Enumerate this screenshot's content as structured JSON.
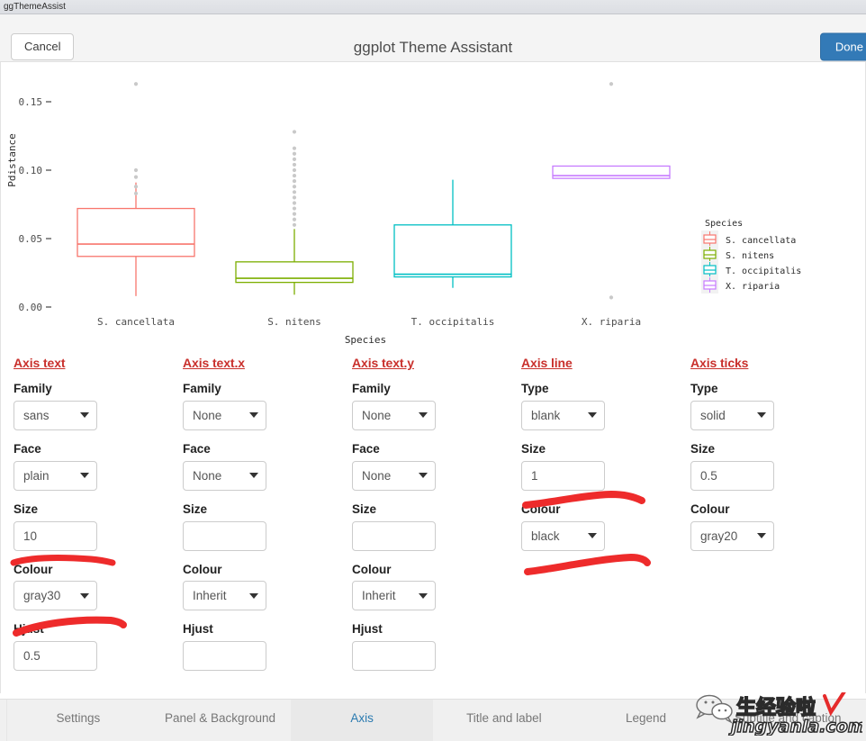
{
  "window": {
    "title": "ggThemeAssist"
  },
  "header": {
    "cancel_label": "Cancel",
    "title": "ggplot Theme Assistant",
    "done_label": "Done"
  },
  "plot": {
    "y_axis_title": "Pdistance",
    "x_axis_title": "Species",
    "y_ticks": [
      "0.00",
      "0.05",
      "0.10",
      "0.15"
    ],
    "x_ticks": [
      "S. cancellata",
      "S. nitens",
      "T. occipitalis",
      "X. riparia"
    ],
    "legend_title": "Species",
    "legend_items": [
      {
        "label": "S. cancellata",
        "colour": "#F8766D"
      },
      {
        "label": "S. nitens",
        "colour": "#7CAE00"
      },
      {
        "label": "T. occipitalis",
        "colour": "#00BFC4"
      },
      {
        "label": "X. riparia",
        "colour": "#C77CFF"
      }
    ]
  },
  "chart_data": {
    "type": "box",
    "title": "",
    "xlabel": "Species",
    "ylabel": "Pdistance",
    "categories": [
      "S. cancellata",
      "S. nitens",
      "T. occipitalis",
      "X. riparia"
    ],
    "ylim": [
      0.0,
      0.175
    ],
    "grid": false,
    "legend_position": "right",
    "series": [
      {
        "name": "S. cancellata",
        "colour": "#F8766D",
        "min": 0.008,
        "q1": 0.037,
        "median": 0.046,
        "q3": 0.072,
        "max": 0.091,
        "outliers": [
          0.163,
          0.1,
          0.095,
          0.088,
          0.083
        ]
      },
      {
        "name": "S. nitens",
        "colour": "#7CAE00",
        "min": 0.009,
        "q1": 0.018,
        "median": 0.021,
        "q3": 0.033,
        "max": 0.057,
        "outliers": [
          0.128,
          0.116,
          0.112,
          0.108,
          0.104,
          0.1,
          0.096,
          0.092,
          0.088,
          0.084,
          0.08,
          0.076,
          0.072,
          0.068,
          0.064,
          0.06
        ]
      },
      {
        "name": "T. occipitalis",
        "colour": "#00BFC4",
        "min": 0.014,
        "q1": 0.022,
        "median": 0.024,
        "q3": 0.06,
        "max": 0.093,
        "outliers": []
      },
      {
        "name": "X. riparia",
        "colour": "#C77CFF",
        "min": 0.094,
        "q1": 0.094,
        "median": 0.096,
        "q3": 0.103,
        "max": 0.103,
        "outliers": [
          0.163,
          0.007
        ]
      }
    ]
  },
  "controls": {
    "columns": [
      {
        "title": "Axis text",
        "fields": [
          {
            "label": "Family",
            "type": "select",
            "value": "sans"
          },
          {
            "label": "Face",
            "type": "select",
            "value": "plain"
          },
          {
            "label": "Size",
            "type": "text",
            "value": "10"
          },
          {
            "label": "Colour",
            "type": "select",
            "value": "gray30"
          },
          {
            "label": "Hjust",
            "type": "text",
            "value": "0.5"
          }
        ]
      },
      {
        "title": "Axis text.x",
        "fields": [
          {
            "label": "Family",
            "type": "select",
            "value": "None"
          },
          {
            "label": "Face",
            "type": "select",
            "value": "None"
          },
          {
            "label": "Size",
            "type": "text",
            "value": ""
          },
          {
            "label": "Colour",
            "type": "select",
            "value": "Inherit"
          },
          {
            "label": "Hjust",
            "type": "text",
            "value": ""
          }
        ]
      },
      {
        "title": "Axis text.y",
        "fields": [
          {
            "label": "Family",
            "type": "select",
            "value": "None"
          },
          {
            "label": "Face",
            "type": "select",
            "value": "None"
          },
          {
            "label": "Size",
            "type": "text",
            "value": ""
          },
          {
            "label": "Colour",
            "type": "select",
            "value": "Inherit"
          },
          {
            "label": "Hjust",
            "type": "text",
            "value": ""
          }
        ]
      },
      {
        "title": "Axis line",
        "fields": [
          {
            "label": "Type",
            "type": "select",
            "value": "blank"
          },
          {
            "label": "Size",
            "type": "text",
            "value": "1"
          },
          {
            "label": "Colour",
            "type": "select",
            "value": "black"
          }
        ]
      },
      {
        "title": "Axis ticks",
        "fields": [
          {
            "label": "Type",
            "type": "select",
            "value": "solid"
          },
          {
            "label": "Size",
            "type": "text",
            "value": "0.5"
          },
          {
            "label": "Colour",
            "type": "select",
            "value": "gray20"
          }
        ]
      }
    ],
    "annotation_colour": "#ee2b2b"
  },
  "tabs": [
    {
      "label": "Settings",
      "active": false
    },
    {
      "label": "Panel & Background",
      "active": false
    },
    {
      "label": "Axis",
      "active": true
    },
    {
      "label": "Title and label",
      "active": false
    },
    {
      "label": "Legend",
      "active": false
    },
    {
      "label": "Subtitle and caption",
      "active": false
    }
  ],
  "watermark": {
    "text": "jingyanla.com",
    "cn_text": "生经验啦"
  }
}
